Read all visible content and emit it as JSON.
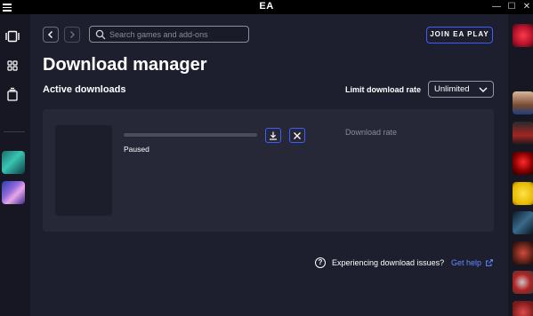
{
  "titlebar": {
    "logo": "EA",
    "controls": {
      "minimize": "—",
      "maximize": "☐",
      "close": "✕"
    }
  },
  "header": {
    "search_placeholder": "Search games and add-ons",
    "join_label": "JOIN EA PLAY"
  },
  "page": {
    "title": "Download manager",
    "section": "Active downloads",
    "limit_label": "Limit download rate",
    "limit_value": "Unlimited"
  },
  "download": {
    "status": "Paused",
    "progress": 0,
    "rate_label": "Download rate"
  },
  "help": {
    "question": "?",
    "text": "Experiencing download issues?",
    "link": "Get help"
  },
  "colors": {
    "accent": "#3f5dff",
    "link": "#5d8bff",
    "background": "#1e1f2e",
    "card": "#262737"
  },
  "icons": {
    "rail": [
      "library-icon",
      "browse-grid-icon",
      "store-icon"
    ],
    "card": [
      "download-icon",
      "close-icon"
    ]
  }
}
